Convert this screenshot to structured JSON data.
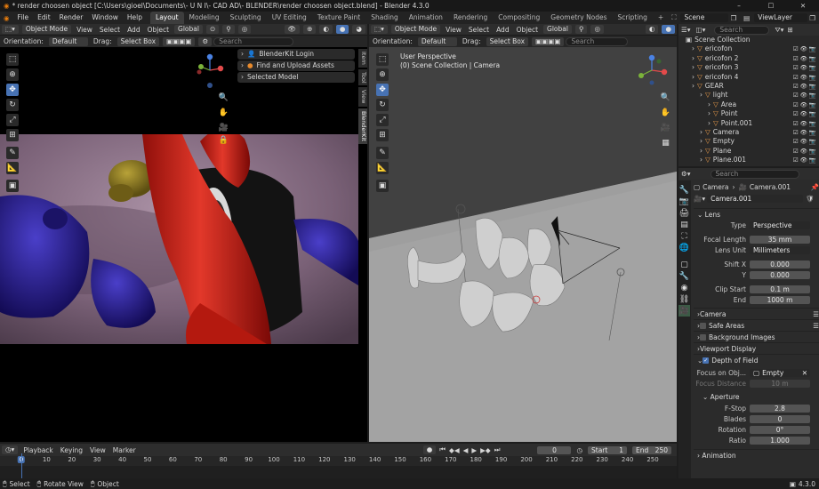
{
  "titlebar": {
    "title": "* render choosen object [C:\\Users\\gioel\\Documents\\- U N I\\- CAD AD\\- BLENDER\\render choosen object.blend] - Blender 4.3.0",
    "minimize": "–",
    "maximize": "☐",
    "close": "✕"
  },
  "menubar": {
    "items": [
      "File",
      "Edit",
      "Render",
      "Window",
      "Help"
    ],
    "workspaces": [
      "Layout",
      "Modeling",
      "Sculpting",
      "UV Editing",
      "Texture Paint",
      "Shading",
      "Animation",
      "Rendering",
      "Compositing",
      "Geometry Nodes",
      "Scripting"
    ],
    "add_workspace": "+",
    "scene": "Scene",
    "view_layer": "ViewLayer"
  },
  "left_view": {
    "mode": "Object Mode",
    "view": "View",
    "select": "Select",
    "add": "Add",
    "object": "Object",
    "transform": "Global",
    "orientation_label": "Orientation:",
    "orientation_value": "Default",
    "drag_label": "Drag:",
    "drag_value": "Select Box",
    "search_placeholder": "Search",
    "npanel": [
      "BlenderKit Login",
      "Find and Upload Assets",
      "Selected Model"
    ],
    "vtabs": [
      "Item",
      "Tool",
      "View",
      "BlenderKit"
    ]
  },
  "right_view": {
    "mode": "Object Mode",
    "view": "View",
    "select": "Select",
    "add": "Add",
    "object": "Object",
    "transform": "Global",
    "orientation_label": "Orientation:",
    "orientation_value": "Default",
    "drag_label": "Drag:",
    "drag_value": "Select Box",
    "search_placeholder": "Search",
    "overlay_line1": "User Perspective",
    "overlay_line2": "(0) Scene Collection | Camera"
  },
  "outliner": {
    "search_placeholder": "Search",
    "root": "Scene Collection",
    "items": [
      {
        "label": "ericofon",
        "indent": 1
      },
      {
        "label": "ericofon 2",
        "indent": 1
      },
      {
        "label": "ericofon 3",
        "indent": 1
      },
      {
        "label": "ericofon 4",
        "indent": 1
      },
      {
        "label": "GEAR",
        "indent": 1
      },
      {
        "label": "light",
        "indent": 2
      },
      {
        "label": "Area",
        "indent": 3
      },
      {
        "label": "Point",
        "indent": 3
      },
      {
        "label": "Point.001",
        "indent": 3
      },
      {
        "label": "Camera",
        "indent": 2
      },
      {
        "label": "Empty",
        "indent": 2
      },
      {
        "label": "Plane",
        "indent": 2
      },
      {
        "label": "Plane.001",
        "indent": 2
      }
    ]
  },
  "properties": {
    "search_placeholder": "Search",
    "breadcrumb_object": "Camera",
    "breadcrumb_data": "Camera.001",
    "datablock": "Camera.001",
    "lens_section": "Lens",
    "type_label": "Type",
    "type_value": "Perspective",
    "focal_label": "Focal Length",
    "focal_value": "35 mm",
    "lens_unit_label": "Lens Unit",
    "lens_unit_value": "Millimeters",
    "shift_x_label": "Shift X",
    "shift_x_value": "0.000",
    "shift_y_label": "Y",
    "shift_y_value": "0.000",
    "clip_start_label": "Clip Start",
    "clip_start_value": "0.1 m",
    "clip_end_label": "End",
    "clip_end_value": "1000 m",
    "sections": [
      "Camera",
      "Safe Areas",
      "Background Images",
      "Viewport Display"
    ],
    "dof_section": "Depth of Field",
    "focus_obj_label": "Focus on Obj...",
    "focus_obj_value": "Empty",
    "focus_dist_label": "Focus Distance",
    "focus_dist_value": "10 m",
    "aperture_section": "Aperture",
    "fstop_label": "F-Stop",
    "fstop_value": "2.8",
    "blades_label": "Blades",
    "blades_value": "0",
    "rotation_label": "Rotation",
    "rotation_value": "0°",
    "ratio_label": "Ratio",
    "ratio_value": "1.000",
    "animation_section": "Animation"
  },
  "timeline": {
    "playback": "Playback",
    "keying": "Keying",
    "view": "View",
    "marker": "Marker",
    "current_frame": "0",
    "start_label": "Start",
    "start_value": "1",
    "end_label": "End",
    "end_value": "250",
    "ruler": [
      "0",
      "10",
      "20",
      "30",
      "40",
      "50",
      "60",
      "70",
      "80",
      "90",
      "100",
      "110",
      "120",
      "130",
      "140",
      "150",
      "160",
      "170",
      "180",
      "190",
      "200",
      "210",
      "220",
      "230",
      "240",
      "250"
    ],
    "playhead": "0"
  },
  "statusbar": {
    "select": "Select",
    "rotate": "Rotate View",
    "object": "Object",
    "version": "4.3.0"
  },
  "colors": {
    "accent": "#4772b3",
    "active_tool": "#4772b3",
    "background": "#1d1d1d",
    "panel": "#2d2d2d"
  }
}
